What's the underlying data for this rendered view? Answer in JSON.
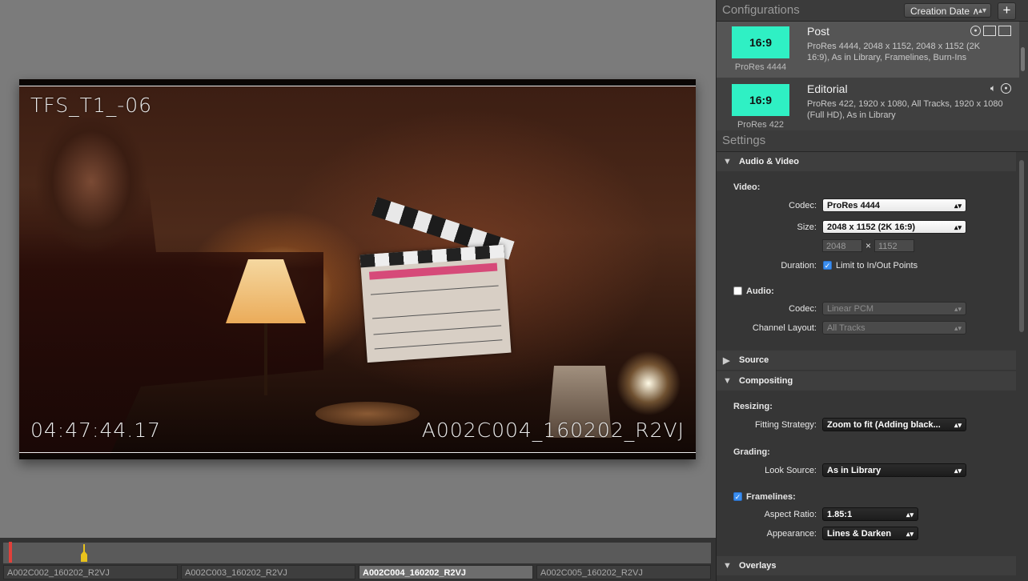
{
  "viewer": {
    "overlay_top_left": "TFS_T1_-06",
    "overlay_bottom_left": "04:47:44.17",
    "overlay_bottom_right": "A002C004_160202_R2VJ"
  },
  "timeline": {
    "clips": [
      {
        "label": "A002C002_160202_R2VJ",
        "active": false
      },
      {
        "label": "A002C003_160202_R2VJ",
        "active": false
      },
      {
        "label": "A002C004_160202_R2VJ",
        "active": true
      },
      {
        "label": "A002C005_160202_R2VJ",
        "active": false
      }
    ]
  },
  "configurations": {
    "title": "Configurations",
    "sort_label": "Creation Date ∧",
    "add_label": "+",
    "items": [
      {
        "thumb": "16:9",
        "thumb_label": "ProRes 4444",
        "name": "Post",
        "desc": "ProRes 4444, 2048 x 1152, 2048 x 1152 (2K 16:9), As in Library, Framelines, Burn-Ins"
      },
      {
        "thumb": "16:9",
        "thumb_label": "ProRes 422",
        "name": "Editorial",
        "desc": "ProRes 422, 1920 x 1080, All Tracks, 1920 x 1080 (Full HD), As in Library"
      }
    ]
  },
  "settings": {
    "title": "Settings",
    "audio_video": {
      "header": "Audio & Video",
      "video_label": "Video:",
      "codec_label": "Codec:",
      "codec_value": "ProRes 4444",
      "size_label": "Size:",
      "size_value": "2048 x 1152 (2K 16:9)",
      "width": "2048",
      "x": "×",
      "height": "1152",
      "duration_label": "Duration:",
      "duration_value": "Limit to In/Out Points",
      "audio_label": "Audio:",
      "audio_codec_label": "Codec:",
      "audio_codec_value": "Linear PCM",
      "channel_label": "Channel Layout:",
      "channel_value": "All Tracks"
    },
    "source": {
      "header": "Source"
    },
    "compositing": {
      "header": "Compositing",
      "resizing_label": "Resizing:",
      "fitting_label": "Fitting Strategy:",
      "fitting_value": "Zoom to fit (Adding black...",
      "grading_label": "Grading:",
      "look_label": "Look Source:",
      "look_value": "As in Library",
      "framelines_label": "Framelines:",
      "aspect_label": "Aspect Ratio:",
      "aspect_value": "1.85:1",
      "appearance_label": "Appearance:",
      "appearance_value": "Lines & Darken"
    },
    "overlays": {
      "header": "Overlays"
    }
  }
}
